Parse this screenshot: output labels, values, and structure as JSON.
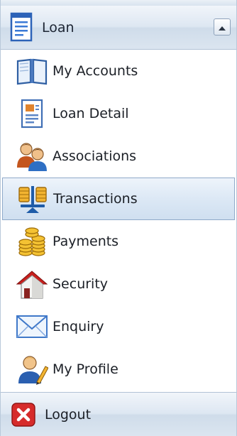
{
  "header": {
    "title": "Loan",
    "icon": "document-icon",
    "collapse_icon": "chevron-up-icon"
  },
  "menu": {
    "items": [
      {
        "label": "My Accounts",
        "icon": "book-icon"
      },
      {
        "label": "Loan Detail",
        "icon": "loan-detail-icon"
      },
      {
        "label": "Associations",
        "icon": "people-icon"
      },
      {
        "label": "Transactions",
        "icon": "coins-scale-icon",
        "selected": true
      },
      {
        "label": "Payments",
        "icon": "coin-stacks-icon"
      },
      {
        "label": "Security",
        "icon": "house-icon"
      },
      {
        "label": "Enquiry",
        "icon": "envelope-icon"
      },
      {
        "label": "My Profile",
        "icon": "user-pen-icon"
      }
    ]
  },
  "footer": {
    "label": "Logout",
    "icon": "close-red-icon"
  },
  "colors": {
    "header_bg": "#dde7f2",
    "selected_bg": "#dce8f5",
    "border": "#b1c2d6",
    "logout_red": "#d62b2b"
  }
}
